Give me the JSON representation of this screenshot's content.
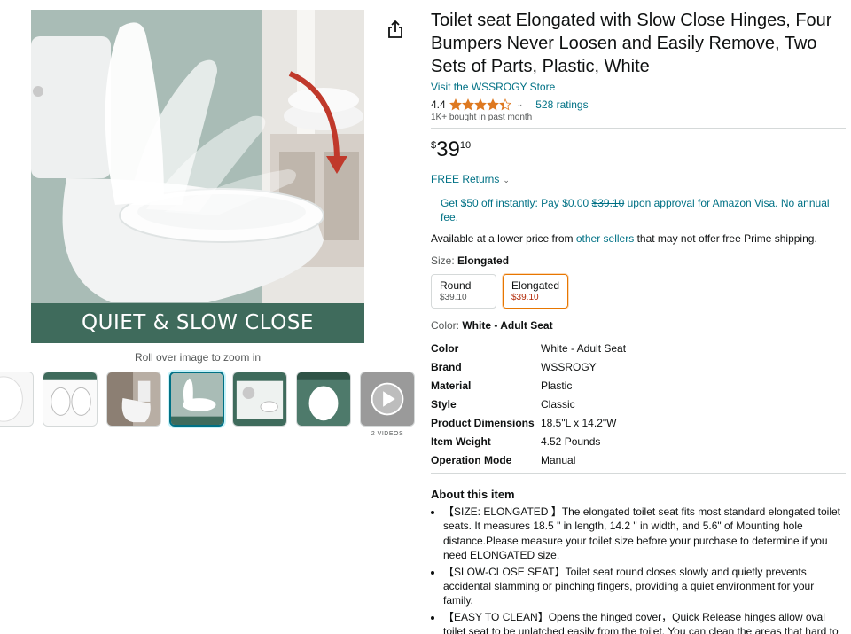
{
  "media": {
    "main_image_banner": "QUIET & SLOW CLOSE",
    "zoom_hint": "Roll over image to zoom in",
    "videos_label": "2 VIDEOS",
    "thumbnails": [
      {
        "name": "thumb-seat-top-view"
      },
      {
        "name": "thumb-size-guide"
      },
      {
        "name": "thumb-bathroom-scene"
      },
      {
        "name": "thumb-quiet-slow-close"
      },
      {
        "name": "thumb-installation-steps"
      },
      {
        "name": "thumb-two-sets-of-parts"
      },
      {
        "name": "thumb-video"
      }
    ]
  },
  "product": {
    "title": "Toilet seat Elongated with Slow Close Hinges, Four Bumpers Never Loosen and Easily Remove, Two Sets of Parts, Plastic, White",
    "store_link": "Visit the WSSROGY Store",
    "rating": "4.4",
    "stars_value": 4.4,
    "ratings_count": "528 ratings",
    "bought": "1K+ bought in past month",
    "price": {
      "symbol": "$",
      "whole": "39",
      "fraction": "10"
    },
    "returns": "FREE Returns",
    "offer": {
      "pre": "Get $50 off instantly: Pay $0.00 ",
      "strike": "$39.10",
      "post": " upon approval for Amazon Visa. No annual fee."
    },
    "lower_price": {
      "pre": "Available at a lower price from ",
      "link": "other sellers",
      "post": " that may not offer free Prime shipping."
    },
    "size": {
      "label": "Size: ",
      "selected": "Elongated",
      "options": [
        {
          "name": "Round",
          "price": "$39.10"
        },
        {
          "name": "Elongated",
          "price": "$39.10"
        }
      ]
    },
    "color": {
      "label": "Color: ",
      "selected": "White - Adult Seat"
    },
    "specs": [
      {
        "key": "Color",
        "value": "White - Adult Seat"
      },
      {
        "key": "Brand",
        "value": "WSSROGY"
      },
      {
        "key": "Material",
        "value": "Plastic"
      },
      {
        "key": "Style",
        "value": "Classic"
      },
      {
        "key": "Product Dimensions",
        "value": "18.5\"L x 14.2\"W"
      },
      {
        "key": "Item Weight",
        "value": "4.52 Pounds"
      },
      {
        "key": "Operation Mode",
        "value": "Manual"
      }
    ],
    "about_title": "About this item",
    "bullets": [
      "【SIZE: ELONGATED 】The elongated toilet seat fits most standard elongated toilet seats. It measures 18.5 \" in length, 14.2 \" in width, and 5.6\" of Mounting hole distance.Please measure your toilet size before your purchase to determine if you need ELONGATED size.",
      "【SLOW-CLOSE SEAT】Toilet seat round closes slowly and quietly prevents accidental slamming or pinching fingers, providing a quiet environment for your family.",
      "【EASY TO CLEAN】Opens the hinged cover，Quick Release hinges allow oval toilet seat to be unlatched easily from the toilet. You can clean the areas that hard to reach, which keeping your bathroom fresh and comfortable."
    ]
  },
  "colors": {
    "link": "#007185",
    "text": "#0f1111",
    "muted": "#565959",
    "star": "#de7921",
    "selected_border": "#e77600",
    "price_red": "#b12704",
    "banner_green": "#3f6b5c"
  }
}
